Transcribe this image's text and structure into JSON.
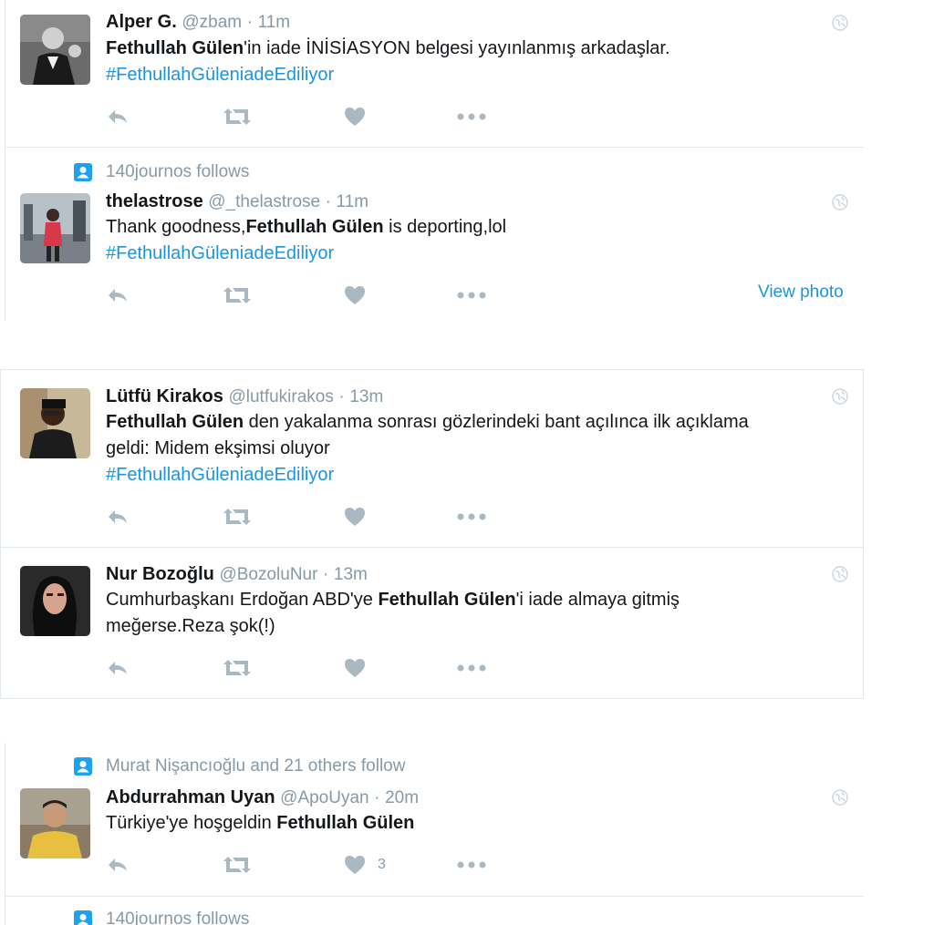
{
  "colors": {
    "accent": "#1b95e0",
    "muted": "#8899a6",
    "icon": "#aab8c2",
    "border": "#e1e8ed"
  },
  "icons": {
    "reply": "reply-icon",
    "retweet": "retweet-icon",
    "like": "heart-icon",
    "more": "more-dots-icon",
    "globe": "globe-icon",
    "follow_context": "person-badge-icon"
  },
  "tweets": [
    {
      "context": "",
      "fullname": "Alper G.",
      "handle": "@zbam",
      "dot": "·",
      "time": "11m",
      "body": [
        {
          "bold": "Fethullah Gülen"
        },
        {
          "text": "'in iade İNİSİASYON belgesi yayınlanmış arkadaşlar."
        }
      ],
      "hashtag": "#FethullahGüleniadeEdiliyor",
      "like_count": "",
      "view_photo": ""
    },
    {
      "context": "140journos follows",
      "fullname": "thelastrose",
      "handle": "@_thelastrose",
      "dot": "·",
      "time": "11m",
      "body": [
        {
          "text": "Thank goodness,"
        },
        {
          "bold": "Fethullah Gülen"
        },
        {
          "text": " is deporting,lol"
        }
      ],
      "hashtag": "#FethullahGüleniadeEdiliyor",
      "like_count": "",
      "view_photo": "View photo"
    },
    {
      "context": "",
      "fullname": "Lütfü Kirakos",
      "handle": "@lutfukirakos",
      "dot": "·",
      "time": "13m",
      "body_line1": [
        {
          "bold": "Fethullah Gülen"
        },
        {
          "text": " den yakalanma sonrası gözlerindeki bant açılınca ilk açıklama"
        }
      ],
      "body_line2": "geldi: Midem ekşimsi oluyor",
      "hashtag": "#FethullahGüleniadeEdiliyor",
      "like_count": "",
      "view_photo": ""
    },
    {
      "context": "",
      "fullname": "Nur Bozoğlu",
      "handle": "@BozoluNur",
      "dot": "·",
      "time": "13m",
      "body_line1": [
        {
          "text": "Cumhurbaşkanı Erdoğan ABD'ye "
        },
        {
          "bold": "Fethullah Gülen"
        },
        {
          "text": "'i iade almaya gitmiş"
        }
      ],
      "body_line2": "meğerse.Reza şok(!)",
      "hashtag": "",
      "like_count": "",
      "view_photo": ""
    },
    {
      "context": "Murat Nişancıoğlu and 21 others follow",
      "fullname": "Abdurrahman Uyan",
      "handle": "@ApoUyan",
      "dot": "·",
      "time": "20m",
      "body": [
        {
          "text": "Türkiye'ye hoşgeldin "
        },
        {
          "bold": "Fethullah Gülen"
        }
      ],
      "hashtag": "",
      "like_count": "3",
      "view_photo": ""
    },
    {
      "context": "140journos follows"
    }
  ]
}
